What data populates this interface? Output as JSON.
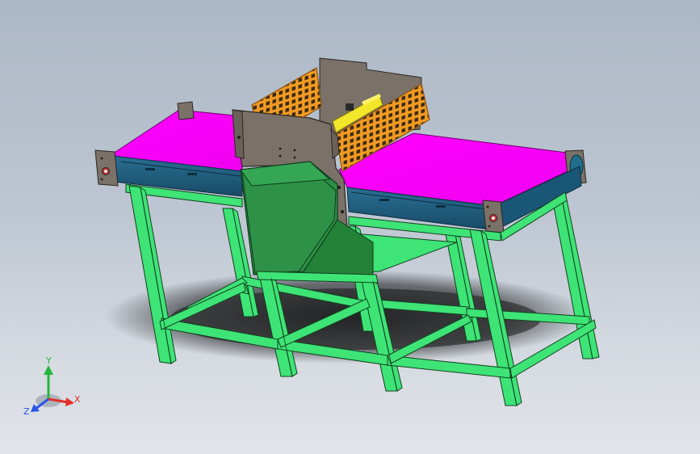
{
  "viewport": {
    "colors": {
      "background_top": "#adb8c6",
      "background_bottom": "#e1e4e9",
      "belt": "#ff00ff",
      "side_rail": "#1f5b7c",
      "frame": "#3ee476",
      "sheet_metal": "#7a7168",
      "guard_mesh": "#f29b22",
      "guide_bar": "#f2e62a",
      "chute": "#2c8f45"
    }
  },
  "triad": {
    "x_label": "X",
    "y_label": "Y",
    "z_label": "Z",
    "x_color": "#e5302a",
    "y_color": "#25b53c",
    "z_color": "#2a55e8"
  }
}
